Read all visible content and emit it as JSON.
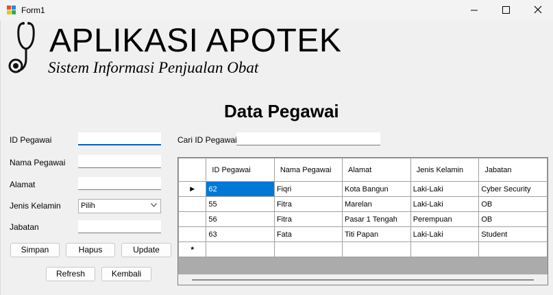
{
  "window": {
    "title": "Form1"
  },
  "header": {
    "title": "APLIKASI APOTEK",
    "subtitle": "Sistem Informasi Penjualan Obat"
  },
  "section_title": "Data Pegawai",
  "form": {
    "id_label": "ID Pegawai",
    "nama_label": "Nama Pegawai",
    "alamat_label": "Alamat",
    "jenis_kelamin_label": "Jenis Kelamin",
    "jenis_kelamin_value": "Pilih",
    "jabatan_label": "Jabatan",
    "id_value": "",
    "nama_value": "",
    "alamat_value": "",
    "jabatan_value": ""
  },
  "search": {
    "label": "Cari ID Pegawai",
    "value": ""
  },
  "buttons": {
    "simpan": "Simpan",
    "hapus": "Hapus",
    "update": "Update",
    "refresh": "Refresh",
    "kembali": "Kembali"
  },
  "grid": {
    "columns": [
      "ID Pegawai",
      "Nama Pegawai",
      "Alamat",
      "Jenis Kelamin",
      "Jabatan"
    ],
    "rows": [
      {
        "id": "62",
        "nama": "Fiqri",
        "alamat": "Kota Bangun",
        "jk": "Laki-Laki",
        "jabatan": "Cyber Security"
      },
      {
        "id": "55",
        "nama": "Fitra",
        "alamat": "Marelan",
        "jk": "Laki-Laki",
        "jabatan": "OB"
      },
      {
        "id": "56",
        "nama": "Fitra",
        "alamat": "Pasar 1 Tengah",
        "jk": "Perempuan",
        "jabatan": "OB"
      },
      {
        "id": "63",
        "nama": "Fata",
        "alamat": "Titi Papan",
        "jk": "Laki-Laki",
        "jabatan": "Student"
      }
    ],
    "current_row_marker": "▶",
    "new_row_marker": "*"
  }
}
